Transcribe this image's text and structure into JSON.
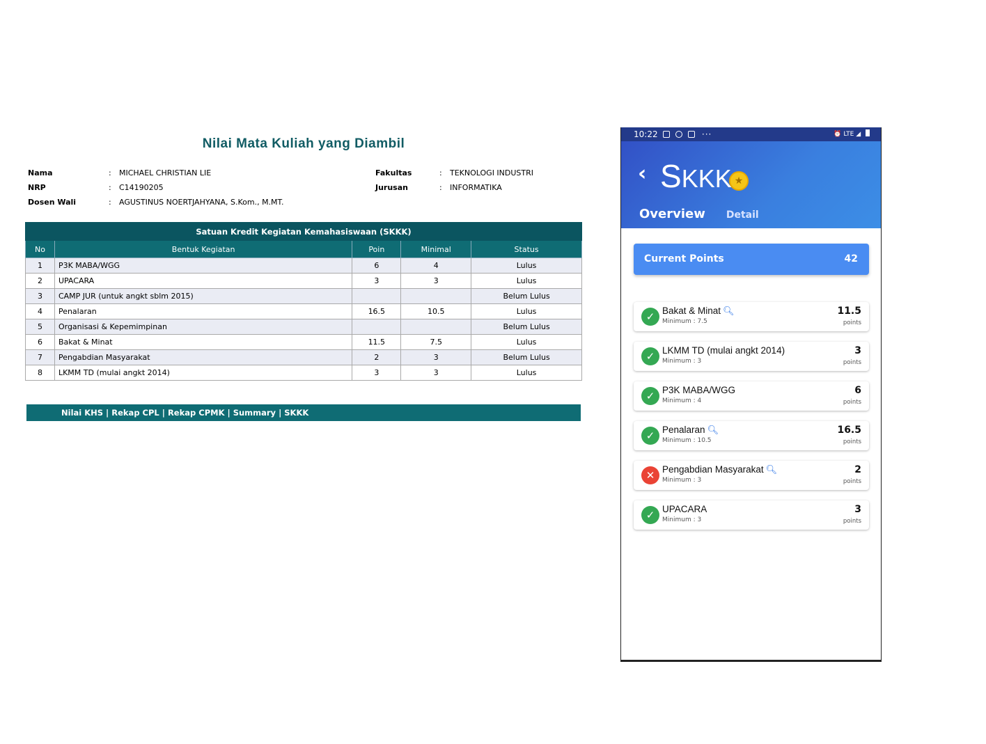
{
  "web": {
    "title": "Nilai Mata Kuliah yang Diambil",
    "info_left": [
      {
        "label": "Nama",
        "value": "MICHAEL CHRISTIAN LIE"
      },
      {
        "label": "NRP",
        "value": "C14190205"
      },
      {
        "label": "Dosen Wali",
        "value": "AGUSTINUS NOERTJAHYANA, S.Kom., M.MT."
      }
    ],
    "info_right": [
      {
        "label": "Fakultas",
        "value": "TEKNOLOGI INDUSTRI"
      },
      {
        "label": "Jurusan",
        "value": "INFORMATIKA"
      }
    ],
    "colon": ":",
    "table": {
      "caption": "Satuan Kredit Kegiatan Kemahasiswaan (SKKK)",
      "headers": [
        "No",
        "Bentuk Kegiatan",
        "Poin",
        "Minimal",
        "Status"
      ],
      "rows": [
        [
          "1",
          "P3K MABA/WGG",
          "6",
          "4",
          "Lulus"
        ],
        [
          "2",
          "UPACARA",
          "3",
          "3",
          "Lulus"
        ],
        [
          "3",
          "CAMP JUR (untuk angkt sblm 2015)",
          "",
          "",
          "Belum Lulus"
        ],
        [
          "4",
          "Penalaran",
          "16.5",
          "10.5",
          "Lulus"
        ],
        [
          "5",
          "Organisasi & Kepemimpinan",
          "",
          "",
          "Belum Lulus"
        ],
        [
          "6",
          "Bakat & Minat",
          "11.5",
          "7.5",
          "Lulus"
        ],
        [
          "7",
          "Pengabdian Masyarakat",
          "2",
          "3",
          "Belum Lulus"
        ],
        [
          "8",
          "LKMM TD (mulai angkt 2014)",
          "3",
          "3",
          "Lulus"
        ]
      ]
    },
    "nav": [
      "Nilai KHS",
      "Rekap CPL",
      "Rekap CPMK",
      "Summary",
      "SKKK"
    ],
    "nav_sep": "|"
  },
  "phone": {
    "time": "10:22",
    "status_dots": "···",
    "status_right": "⏰ LTE ◢",
    "back_icon": "‹",
    "title_first": "S",
    "title_rest": "KKK",
    "coin_icon": "★",
    "tabs": [
      "Overview",
      "Detail"
    ],
    "current_points_label": "Current Points",
    "current_points_value": "42",
    "magnifier": "🔍︎",
    "items": [
      {
        "name": "Bakat & Minat",
        "search": true,
        "minimum": "Minimum : 7.5",
        "points": "11.5",
        "unit": "points",
        "status": "ok",
        "icon": "✓"
      },
      {
        "name": "LKMM TD (mulai angkt 2014)",
        "search": false,
        "minimum": "Minimum : 3",
        "points": "3",
        "unit": "points",
        "status": "ok",
        "icon": "✓"
      },
      {
        "name": "P3K MABA/WGG",
        "search": false,
        "minimum": "Minimum : 4",
        "points": "6",
        "unit": "points",
        "status": "ok",
        "icon": "✓"
      },
      {
        "name": "Penalaran",
        "search": true,
        "minimum": "Minimum : 10.5",
        "points": "16.5",
        "unit": "points",
        "status": "ok",
        "icon": "✓"
      },
      {
        "name": "Pengabdian Masyarakat",
        "search": true,
        "minimum": "Minimum : 3",
        "points": "2",
        "unit": "points",
        "status": "no",
        "icon": "✕"
      },
      {
        "name": "UPACARA",
        "search": false,
        "minimum": "Minimum : 3",
        "points": "3",
        "unit": "points",
        "status": "ok",
        "icon": "✓"
      }
    ],
    "colors": {
      "ok": "#34a853",
      "no": "#ea4335",
      "accent": "#4a8cf2",
      "header": "#0f6c74"
    }
  }
}
